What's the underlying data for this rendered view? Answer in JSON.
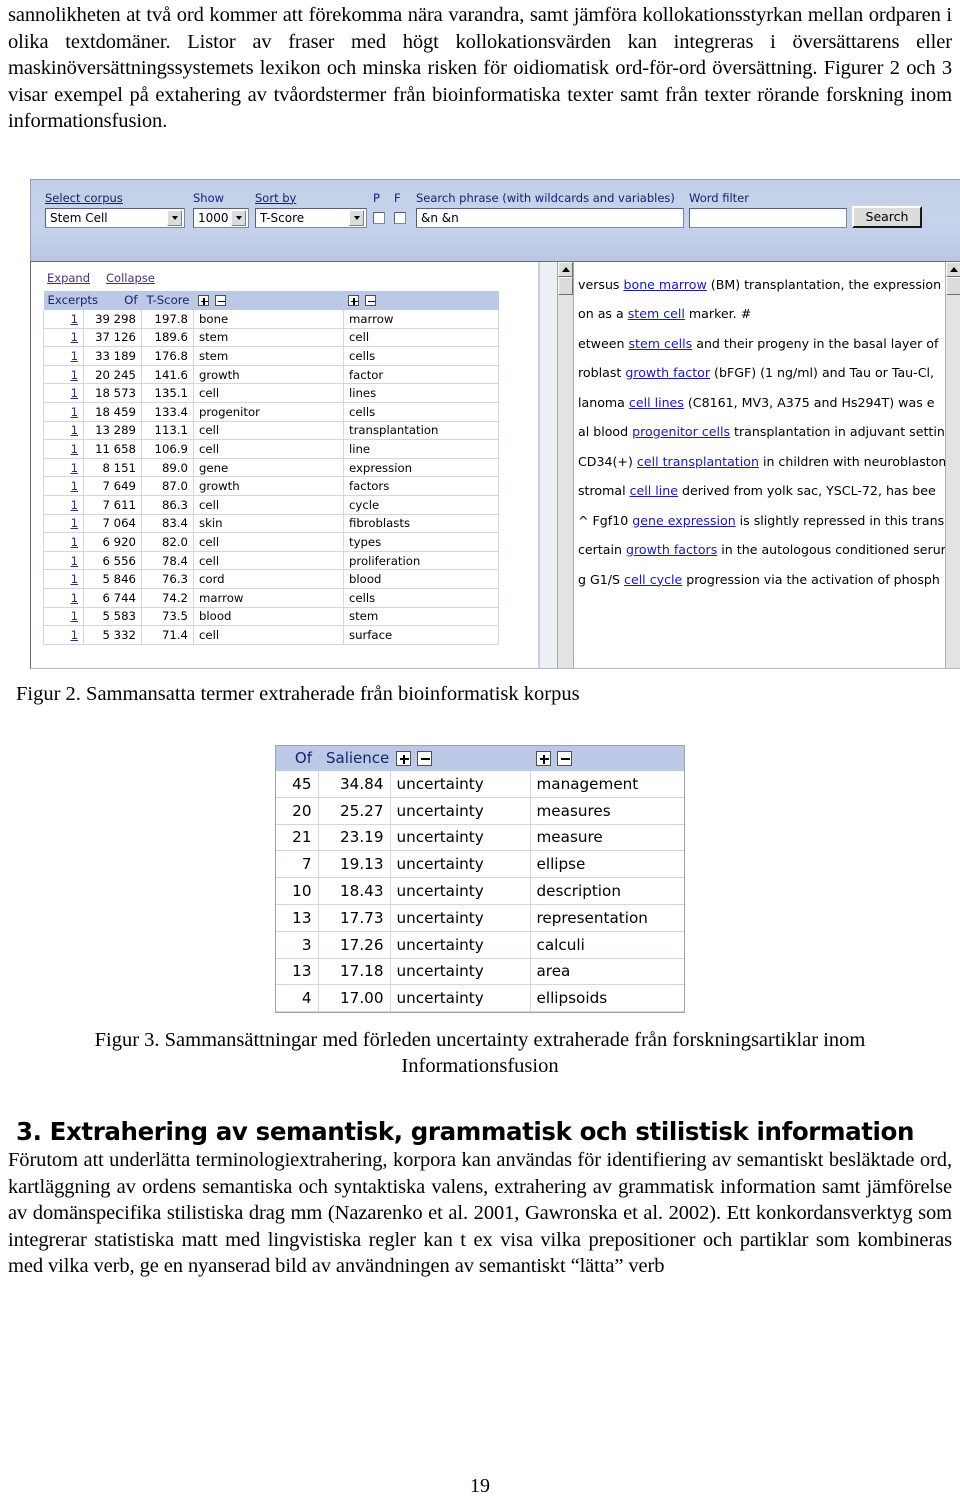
{
  "document": {
    "top_paragraph": "sannolikheten at två ord kommer att förekomma nära varandra, samt jämföra kollokationsstyrkan mellan ordparen i olika textdomäner. Listor av fraser med högt kollokationsvärden kan integreras i översättarens eller maskinöversättningssystemets lexikon och minska risken för oidiomatisk ord-för-ord översättning. Figurer 2 och 3 visar exempel på extahering av tvåordstermer från bioinformatiska texter samt från texter rörande forskning inom informationsfusion.",
    "figure2_caption": "Figur 2. Sammansatta termer extraherade från bioinformatisk korpus",
    "figure3_caption_line1": "Figur 3. Sammansättningar med förleden uncertainty extraherade från forskningsartiklar inom",
    "figure3_caption_line2": "Informationsfusion",
    "section3_heading": "3. Extrahering av semantisk, grammatisk och stilistisk information",
    "section3_paragraph": "Förutom att underlätta terminologiextrahering, korpora kan användas för identifiering av semantiskt besläktade ord, kartläggning av ordens semantiska och syntaktiska valens, extrahering av grammatisk information samt jämförelse av domänspecifika stilistiska drag mm (Nazarenko et al. 2001, Gawronska et al. 2002). Ett konkordansverktyg som integrerar statistiska matt med lingvistiska regler kan t ex visa vilka prepositioner och partiklar som kombineras med vilka verb, ge en nyanserad bild av användningen av semantiskt “lätta” verb",
    "page_number": "19"
  },
  "figure2": {
    "toolbar": {
      "select_corpus_label": "Select corpus",
      "select_corpus_value": "Stem Cell",
      "show_label": "Show",
      "show_value": "1000",
      "sort_by_label": "Sort by",
      "sort_by_value": "T-Score",
      "p_label": "P",
      "f_label": "F",
      "search_phrase_label": "Search phrase (with wildcards and variables)",
      "search_phrase_value": "&n &n",
      "word_filter_label": "Word filter",
      "word_filter_value": "",
      "search_button": "Search"
    },
    "controls": {
      "expand": "Expand",
      "collapse": "Collapse"
    },
    "table": {
      "headers": [
        "Excerpts",
        "Of",
        "T-Score",
        "",
        ""
      ],
      "rows": [
        {
          "excerpts": "1",
          "of": "39 298",
          "tscore": "197.8",
          "w1": "bone",
          "w2": "marrow"
        },
        {
          "excerpts": "1",
          "of": "37 126",
          "tscore": "189.6",
          "w1": "stem",
          "w2": "cell"
        },
        {
          "excerpts": "1",
          "of": "33 189",
          "tscore": "176.8",
          "w1": "stem",
          "w2": "cells"
        },
        {
          "excerpts": "1",
          "of": "20 245",
          "tscore": "141.6",
          "w1": "growth",
          "w2": "factor"
        },
        {
          "excerpts": "1",
          "of": "18 573",
          "tscore": "135.1",
          "w1": "cell",
          "w2": "lines"
        },
        {
          "excerpts": "1",
          "of": "18 459",
          "tscore": "133.4",
          "w1": "progenitor",
          "w2": "cells"
        },
        {
          "excerpts": "1",
          "of": "13 289",
          "tscore": "113.1",
          "w1": "cell",
          "w2": "transplantation"
        },
        {
          "excerpts": "1",
          "of": "11 658",
          "tscore": "106.9",
          "w1": "cell",
          "w2": "line"
        },
        {
          "excerpts": "1",
          "of": "8 151",
          "tscore": "89.0",
          "w1": "gene",
          "w2": "expression"
        },
        {
          "excerpts": "1",
          "of": "7 649",
          "tscore": "87.0",
          "w1": "growth",
          "w2": "factors"
        },
        {
          "excerpts": "1",
          "of": "7 611",
          "tscore": "86.3",
          "w1": "cell",
          "w2": "cycle"
        },
        {
          "excerpts": "1",
          "of": "7 064",
          "tscore": "83.4",
          "w1": "skin",
          "w2": "fibroblasts"
        },
        {
          "excerpts": "1",
          "of": "6 920",
          "tscore": "82.0",
          "w1": "cell",
          "w2": "types"
        },
        {
          "excerpts": "1",
          "of": "6 556",
          "tscore": "78.4",
          "w1": "cell",
          "w2": "proliferation"
        },
        {
          "excerpts": "1",
          "of": "5 846",
          "tscore": "76.3",
          "w1": "cord",
          "w2": "blood"
        },
        {
          "excerpts": "1",
          "of": "6 744",
          "tscore": "74.2",
          "w1": "marrow",
          "w2": "cells"
        },
        {
          "excerpts": "1",
          "of": "5 583",
          "tscore": "73.5",
          "w1": "blood",
          "w2": "stem"
        },
        {
          "excerpts": "1",
          "of": "5 332",
          "tscore": "71.4",
          "w1": "cell",
          "w2": "surface"
        }
      ]
    },
    "concordance": [
      {
        "pre": " versus ",
        "term": "bone marrow",
        "post": " (BM) transplantation, the expression"
      },
      {
        "pre": "on as a ",
        "term": "stem cell",
        "post": " marker. #"
      },
      {
        "pre": "etween ",
        "term": "stem cells",
        "post": " and their progeny in the basal layer of"
      },
      {
        "pre": "roblast ",
        "term": "growth factor",
        "post": " (bFGF) (1 ng/ml) and Tau or Tau-Cl,"
      },
      {
        "pre": "lanoma ",
        "term": "cell lines",
        "post": " (C8161, MV3, A375 and Hs294T) was e"
      },
      {
        "pre": "al blood ",
        "term": "progenitor cells",
        "post": " transplantation in adjuvant setting"
      },
      {
        "pre": "CD34(+) ",
        "term": "cell transplantation",
        "post": " in children with neuroblastoma"
      },
      {
        "pre": "stromal ",
        "term": "cell line",
        "post": " derived from yolk sac, YSCL-72, has bee"
      },
      {
        "pre": "^ Fgf10 ",
        "term": "gene expression",
        "post": " is slightly repressed in this trans"
      },
      {
        "pre": "certain ",
        "term": "growth factors",
        "post": " in the autologous conditioned serur"
      },
      {
        "pre": "g G1/S ",
        "term": "cell cycle",
        "post": " progression via the activation of phosph"
      }
    ]
  },
  "figure3": {
    "table": {
      "headers": [
        "Of",
        "Salience",
        "",
        ""
      ],
      "rows": [
        {
          "of": "45",
          "salience": "34.84",
          "w1": "uncertainty",
          "w2": "management"
        },
        {
          "of": "20",
          "salience": "25.27",
          "w1": "uncertainty",
          "w2": "measures"
        },
        {
          "of": "21",
          "salience": "23.19",
          "w1": "uncertainty",
          "w2": "measure"
        },
        {
          "of": "7",
          "salience": "19.13",
          "w1": "uncertainty",
          "w2": "ellipse"
        },
        {
          "of": "10",
          "salience": "18.43",
          "w1": "uncertainty",
          "w2": "description"
        },
        {
          "of": "13",
          "salience": "17.73",
          "w1": "uncertainty",
          "w2": "representation"
        },
        {
          "of": "3",
          "salience": "17.26",
          "w1": "uncertainty",
          "w2": "calculi"
        },
        {
          "of": "13",
          "salience": "17.18",
          "w1": "uncertainty",
          "w2": "area"
        },
        {
          "of": "4",
          "salience": "17.00",
          "w1": "uncertainty",
          "w2": "ellipsoids"
        }
      ]
    }
  },
  "colors": {
    "toolbar_bg": "#c3d0e8",
    "table_header_bg": "#bcc9e6",
    "link_blue": "#12246e",
    "concordance_link": "#1a1ab0"
  }
}
